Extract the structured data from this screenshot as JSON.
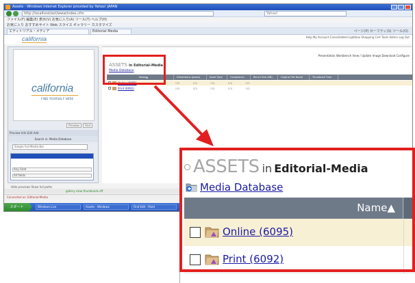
{
  "browser": {
    "title": "Assets - Windows Internet Explorer provided by Yahoo! JAPAN",
    "url": "http://localhost/ext/www/index.cfm",
    "search_placeholder": "Yahoo!",
    "menu": "ファイル(F) 編集(E) 表示(V) お気に入り(A) ツール(T) ヘルプ(H)",
    "favorites": "お気に入り  おすすめサイト  Web スライス ギャラリー  カスタマイズ",
    "tabs": [
      "エディトリアル・メディア",
      "Editorial Media"
    ],
    "tools": "ページ(P)  セーフティ(S)  ツール(O)"
  },
  "app": {
    "logo": "california",
    "logo_tagline": "FIND YOURSELF HERE",
    "top_nav": "Help  My Account  Consolidated Lightbox  Shopping Cart  Tools  Admin  Log Out",
    "toolbar": "Presentation Workbench    View / Update Image    Download    Configure",
    "left_tools": "Preview  Info  Edit  Add",
    "preview_buttons": [
      "Preview",
      "Find"
    ],
    "search_heading": "Search in: Media Database",
    "search_scope": "Simple  Full Media Bar",
    "lists": [
      "Any Field",
      "All fields"
    ],
    "left_options": "Hide previews   Show full paths",
    "view_options": "gallery view   thumbnails off",
    "status_text": "Connected as: Editorial-Media",
    "taskbar_start": "スタート",
    "taskbar_tasks": [
      "Windows Live",
      "Assets - Windows",
      "Find Edit - Paint",
      "Microsoft Word"
    ],
    "tray_time": "10:43"
  },
  "small_list": {
    "title": "ASSETS",
    "in_label": "in Editorial-Media",
    "breadcrumb": "Media Database",
    "columns": [
      "Name▲",
      "Dimensions (pixels)",
      "Asset Type",
      "Compliance",
      "Bench Size (KB)",
      "Original File Name",
      "Thumbnail Time"
    ],
    "rows": [
      "Online (6095)",
      "Print (6092)"
    ],
    "placeholders": "n/a n/a n/a n/a n/a"
  },
  "zoom": {
    "bullet": "◦",
    "title": "ASSETS",
    "in_label": "in",
    "set_name": "Editorial-Media",
    "breadcrumb": "Media Database",
    "column_name": "Name▲",
    "rows": [
      {
        "label": "Online (6095)"
      },
      {
        "label": "Print (6092)"
      }
    ]
  },
  "colors": {
    "highlight": "#e21f1f",
    "header_bg": "#6f7a89",
    "row_highlight": "#f8f0d4",
    "link": "#1a1aa6"
  }
}
